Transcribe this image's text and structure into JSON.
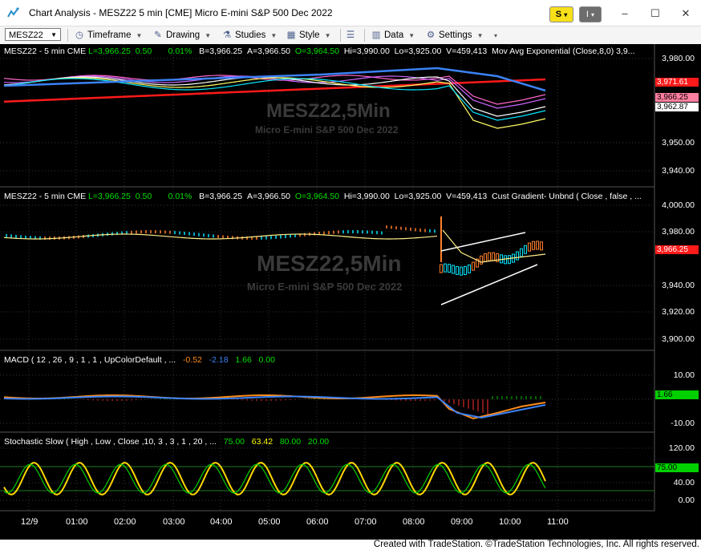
{
  "window": {
    "title": "Chart Analysis - MESZ22 5 min [CME] Micro E-mini S&P 500 Dec 2022",
    "btn_s": "S",
    "btn_i": "I"
  },
  "toolbar": {
    "symbol": "MESZ22",
    "items": [
      "Timeframe",
      "Drawing",
      "Studies",
      "Style",
      "Data",
      "Settings"
    ]
  },
  "panels": {
    "p1": {
      "label_main": "MESZ22 - 5 min  CME  ",
      "last": "L=3,966.25",
      "chg": "0.50",
      "pct": "0.01%",
      "bid": "B=3,966.25",
      "ask": "A=3,966.50",
      "open": "O=3,964.50",
      "high": "Hi=3,990.00",
      "low": "Lo=3,925.00",
      "vol": "V=459,413",
      "study": "Mov Avg Exponential (Close,8,0)   3,9..."
    },
    "p2": {
      "label_main": "MESZ22 - 5 min  CME  ",
      "last": "L=3,966.25",
      "chg": "0.50",
      "pct": "0.01%",
      "bid": "B=3,966.25",
      "ask": "A=3,966.50",
      "open": "O=3,964.50",
      "high": "Hi=3,990.00",
      "low": "Lo=3,925.00",
      "vol": "V=459,413",
      "study": "Cust Gradient- Unbnd ( Close , false , ..."
    },
    "p3": {
      "label": "MACD ( 12 , 26 , 9 , 1 , 1 , UpColorDefault , ...",
      "v1": "-0.52",
      "v2": "-2.18",
      "v3": "1.66",
      "v4": "0.00"
    },
    "p4": {
      "label": "Stochastic Slow ( High , Low , Close ,10, 3 , 3 , 1 , 20 , ...",
      "v1": "75.00",
      "v2": "63.42",
      "v3": "80.00",
      "v4": "20.00"
    }
  },
  "watermarks": {
    "symbol": "MESZ22,5Min",
    "description": "Micro E-mini S&P 500 Dec 2022"
  },
  "axes": {
    "p1": [
      "3,980.00",
      "3,950.00",
      "3,940.00"
    ],
    "p2": [
      "4,000.00",
      "3,980.00",
      "3,940.00",
      "3,920.00",
      "3,900.00"
    ],
    "p3": [
      "10.00",
      "-10.00"
    ],
    "p4": [
      "120.00",
      "40.00",
      "0.00"
    ],
    "time": [
      "12/9",
      "01:00",
      "02:00",
      "03:00",
      "04:00",
      "05:00",
      "06:00",
      "07:00",
      "08:00",
      "09:00",
      "10:00",
      "11:00"
    ]
  },
  "tags": {
    "p1": [
      "3,971.61",
      "3,966.25",
      "3,962.87"
    ],
    "p2": [
      "3,966.25"
    ],
    "p3": [
      "1.66"
    ],
    "p4": [
      "75.00"
    ]
  },
  "colors": {
    "background": "#000000",
    "up": "#00e5ff",
    "down": "#ff7f2a",
    "ema_red": "#ff1a1a",
    "ema_blue": "#3b82f6",
    "macd": "#ff8c1a",
    "signal": "#3b82f6",
    "stoch_k": "#ffd700",
    "stoch_d": "#00d000"
  },
  "status": "Created with TradeStation. ©TradeStation Technologies, Inc. All rights reserved."
}
